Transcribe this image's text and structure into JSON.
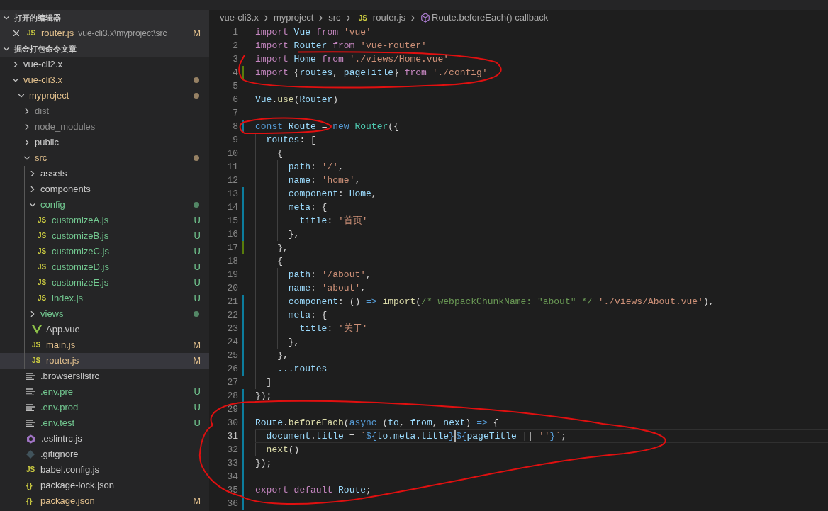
{
  "sidebar": {
    "open_editors": {
      "title": "打开的编辑器",
      "expanded": true,
      "items": [
        {
          "name": "router.js",
          "path": "vue-cli3.x\\myproject\\src",
          "kind": "js",
          "icon_text": "JS",
          "badge": "M",
          "color": "#e2c08d"
        }
      ]
    },
    "workspace": {
      "title": "掘金打包命令文章",
      "expanded": true,
      "tree": [
        {
          "name": "vue-cli2.x",
          "kind": "folder",
          "expanded": false
        },
        {
          "name": "vue-cli3.x",
          "kind": "folder",
          "expanded": true,
          "color": "#e2c08d",
          "dot": true,
          "children": [
            {
              "name": "myproject",
              "kind": "folder",
              "expanded": true,
              "color": "#e2c08d",
              "dot": true,
              "children": [
                {
                  "name": "dist",
                  "kind": "folder",
                  "expanded": false,
                  "color": "#8c8c8c"
                },
                {
                  "name": "node_modules",
                  "kind": "folder",
                  "expanded": false,
                  "color": "#8c8c8c"
                },
                {
                  "name": "public",
                  "kind": "folder",
                  "expanded": false
                },
                {
                  "name": "src",
                  "kind": "folder",
                  "expanded": true,
                  "color": "#e2c08d",
                  "dot": true,
                  "children": [
                    {
                      "name": "assets",
                      "kind": "folder",
                      "expanded": false
                    },
                    {
                      "name": "components",
                      "kind": "folder",
                      "expanded": false
                    },
                    {
                      "name": "config",
                      "kind": "folder",
                      "expanded": true,
                      "color": "#73c991",
                      "dot": true,
                      "children": [
                        {
                          "name": "customizeA.js",
                          "kind": "js",
                          "icon_text": "JS",
                          "color": "#73c991",
                          "badge": "U"
                        },
                        {
                          "name": "customizeB.js",
                          "kind": "js",
                          "icon_text": "JS",
                          "color": "#73c991",
                          "badge": "U"
                        },
                        {
                          "name": "customizeC.js",
                          "kind": "js",
                          "icon_text": "JS",
                          "color": "#73c991",
                          "badge": "U"
                        },
                        {
                          "name": "customizeD.js",
                          "kind": "js",
                          "icon_text": "JS",
                          "color": "#73c991",
                          "badge": "U"
                        },
                        {
                          "name": "customizeE.js",
                          "kind": "js",
                          "icon_text": "JS",
                          "color": "#73c991",
                          "badge": "U"
                        },
                        {
                          "name": "index.js",
                          "kind": "js",
                          "icon_text": "JS",
                          "color": "#73c991",
                          "badge": "U"
                        }
                      ]
                    },
                    {
                      "name": "views",
                      "kind": "folder",
                      "expanded": false,
                      "color": "#73c991",
                      "dot": true
                    },
                    {
                      "name": "App.vue",
                      "kind": "vue"
                    },
                    {
                      "name": "main.js",
                      "kind": "js",
                      "icon_text": "JS",
                      "color": "#e2c08d",
                      "badge": "M",
                      "selected": false
                    },
                    {
                      "name": "router.js",
                      "kind": "js",
                      "icon_text": "JS",
                      "color": "#e2c08d",
                      "badge": "M",
                      "selected": true
                    }
                  ]
                },
                {
                  "name": ".browserslistrc",
                  "kind": "lines"
                },
                {
                  "name": ".env.pre",
                  "kind": "lines",
                  "color": "#73c991",
                  "badge": "U"
                },
                {
                  "name": ".env.prod",
                  "kind": "lines",
                  "color": "#73c991",
                  "badge": "U"
                },
                {
                  "name": ".env.test",
                  "kind": "lines",
                  "color": "#73c991",
                  "badge": "U"
                },
                {
                  "name": ".eslintrc.js",
                  "kind": "eslint"
                },
                {
                  "name": ".gitignore",
                  "kind": "git"
                },
                {
                  "name": "babel.config.js",
                  "kind": "js",
                  "icon_text": "JS"
                },
                {
                  "name": "package-lock.json",
                  "kind": "json",
                  "icon_text": "{}"
                },
                {
                  "name": "package.json",
                  "kind": "json",
                  "icon_text": "{}",
                  "color": "#e2c08d",
                  "badge": "M"
                }
              ]
            }
          ]
        }
      ]
    }
  },
  "breadcrumb": [
    {
      "kind": "folder",
      "text": "vue-cli3.x"
    },
    {
      "kind": "folder",
      "text": "myproject"
    },
    {
      "kind": "folder",
      "text": "src"
    },
    {
      "kind": "js",
      "icon_text": "JS",
      "text": "router.js"
    },
    {
      "kind": "symbol",
      "text": "Route.beforeEach() callback"
    }
  ],
  "code": [
    {
      "n": "1",
      "t": [
        {
          "kind": "kw",
          "text": "import "
        },
        {
          "kind": "var",
          "text": "Vue "
        },
        {
          "kind": "kw",
          "text": "from "
        },
        {
          "kind": "str",
          "text": "'vue'"
        }
      ]
    },
    {
      "n": "2",
      "t": [
        {
          "kind": "kw",
          "text": "import "
        },
        {
          "kind": "var",
          "text": "Router "
        },
        {
          "kind": "kw",
          "text": "from "
        },
        {
          "kind": "str",
          "text": "'vue-router'"
        }
      ]
    },
    {
      "n": "3",
      "t": [
        {
          "kind": "kw",
          "text": "import "
        },
        {
          "kind": "var",
          "text": "Home "
        },
        {
          "kind": "kw",
          "text": "from "
        },
        {
          "kind": "str",
          "text": "'./views/Home.vue'"
        }
      ]
    },
    {
      "n": "4",
      "color": "#587c0c",
      "t": [
        {
          "kind": "kw",
          "text": "import "
        },
        {
          "kind": "p",
          "text": "{"
        },
        {
          "kind": "var",
          "text": "routes"
        },
        {
          "kind": "p",
          "text": ", "
        },
        {
          "kind": "var",
          "text": "pageTitle"
        },
        {
          "kind": "p",
          "text": "} "
        },
        {
          "kind": "kw",
          "text": "from "
        },
        {
          "kind": "str",
          "text": "'./config'"
        }
      ]
    },
    {
      "n": "5"
    },
    {
      "n": "6",
      "t": [
        {
          "kind": "var",
          "text": "Vue"
        },
        {
          "kind": "p",
          "text": "."
        },
        {
          "kind": "fn",
          "text": "use"
        },
        {
          "kind": "p",
          "text": "("
        },
        {
          "kind": "var",
          "text": "Router"
        },
        {
          "kind": "p",
          "text": ")"
        }
      ]
    },
    {
      "n": "7"
    },
    {
      "n": "8",
      "color": "#0c7d9d",
      "t": [
        {
          "kind": "blue",
          "text": "const "
        },
        {
          "kind": "var",
          "text": "Route "
        },
        {
          "kind": "p",
          "text": "= "
        },
        {
          "kind": "blue",
          "text": "new "
        },
        {
          "kind": "cls",
          "text": "Router"
        },
        {
          "kind": "p",
          "text": "({"
        }
      ]
    },
    {
      "n": "9",
      "t": [
        {
          "kind": "var",
          "text": "  routes"
        },
        {
          "kind": "p",
          "text": ": ["
        }
      ]
    },
    {
      "n": "10",
      "t": [
        {
          "kind": "p",
          "text": "    {"
        }
      ]
    },
    {
      "n": "11",
      "t": [
        {
          "kind": "var",
          "text": "      path"
        },
        {
          "kind": "p",
          "text": ": "
        },
        {
          "kind": "str",
          "text": "'/'"
        },
        {
          "kind": "p",
          "text": ","
        }
      ]
    },
    {
      "n": "12",
      "t": [
        {
          "kind": "var",
          "text": "      name"
        },
        {
          "kind": "p",
          "text": ": "
        },
        {
          "kind": "str",
          "text": "'home'"
        },
        {
          "kind": "p",
          "text": ","
        }
      ]
    },
    {
      "n": "13",
      "color": "#0c7d9d",
      "t": [
        {
          "kind": "var",
          "text": "      component"
        },
        {
          "kind": "p",
          "text": ": "
        },
        {
          "kind": "var",
          "text": "Home"
        },
        {
          "kind": "p",
          "text": ","
        }
      ]
    },
    {
      "n": "14",
      "color": "#0c7d9d",
      "t": [
        {
          "kind": "var",
          "text": "      meta"
        },
        {
          "kind": "p",
          "text": ": {"
        }
      ]
    },
    {
      "n": "15",
      "color": "#0c7d9d",
      "t": [
        {
          "kind": "var",
          "text": "        title"
        },
        {
          "kind": "p",
          "text": ": "
        },
        {
          "kind": "str",
          "text": "'首页'"
        }
      ]
    },
    {
      "n": "16",
      "color": "#0c7d9d",
      "t": [
        {
          "kind": "p",
          "text": "      },"
        }
      ]
    },
    {
      "n": "17",
      "color": "#587c0c",
      "t": [
        {
          "kind": "p",
          "text": "    },"
        }
      ]
    },
    {
      "n": "18",
      "t": [
        {
          "kind": "p",
          "text": "    {"
        }
      ]
    },
    {
      "n": "19",
      "t": [
        {
          "kind": "var",
          "text": "      path"
        },
        {
          "kind": "p",
          "text": ": "
        },
        {
          "kind": "str",
          "text": "'/about'"
        },
        {
          "kind": "p",
          "text": ","
        }
      ]
    },
    {
      "n": "20",
      "t": [
        {
          "kind": "var",
          "text": "      name"
        },
        {
          "kind": "p",
          "text": ": "
        },
        {
          "kind": "str",
          "text": "'about'"
        },
        {
          "kind": "p",
          "text": ","
        }
      ]
    },
    {
      "n": "21",
      "color": "#0c7d9d",
      "t": [
        {
          "kind": "var",
          "text": "      component"
        },
        {
          "kind": "p",
          "text": ": () "
        },
        {
          "kind": "blue",
          "text": "=> "
        },
        {
          "kind": "fn",
          "text": "import"
        },
        {
          "kind": "p",
          "text": "("
        },
        {
          "kind": "cmt",
          "text": "/* webpackChunkName: \"about\" */ "
        },
        {
          "kind": "str",
          "text": "'./views/About.vue'"
        },
        {
          "kind": "p",
          "text": "),"
        }
      ]
    },
    {
      "n": "22",
      "color": "#0c7d9d",
      "t": [
        {
          "kind": "var",
          "text": "      meta"
        },
        {
          "kind": "p",
          "text": ": {"
        }
      ]
    },
    {
      "n": "23",
      "color": "#0c7d9d",
      "t": [
        {
          "kind": "var",
          "text": "        title"
        },
        {
          "kind": "p",
          "text": ": "
        },
        {
          "kind": "str",
          "text": "'关于'"
        }
      ]
    },
    {
      "n": "24",
      "color": "#0c7d9d",
      "t": [
        {
          "kind": "p",
          "text": "      },"
        }
      ]
    },
    {
      "n": "25",
      "color": "#0c7d9d",
      "t": [
        {
          "kind": "p",
          "text": "    },"
        }
      ]
    },
    {
      "n": "26",
      "color": "#0c7d9d",
      "t": [
        {
          "kind": "var",
          "text": "    ...routes"
        }
      ]
    },
    {
      "n": "27",
      "t": [
        {
          "kind": "p",
          "text": "  ]"
        }
      ]
    },
    {
      "n": "28",
      "color": "#0c7d9d",
      "t": [
        {
          "kind": "p",
          "text": "});"
        }
      ]
    },
    {
      "n": "29",
      "color": "#0c7d9d"
    },
    {
      "n": "30",
      "color": "#0c7d9d",
      "t": [
        {
          "kind": "var",
          "text": "Route"
        },
        {
          "kind": "p",
          "text": "."
        },
        {
          "kind": "fn",
          "text": "beforeEach"
        },
        {
          "kind": "p",
          "text": "("
        },
        {
          "kind": "blue",
          "text": "async "
        },
        {
          "kind": "p",
          "text": "("
        },
        {
          "kind": "var",
          "text": "to"
        },
        {
          "kind": "p",
          "text": ", "
        },
        {
          "kind": "var",
          "text": "from"
        },
        {
          "kind": "p",
          "text": ", "
        },
        {
          "kind": "var",
          "text": "next"
        },
        {
          "kind": "p",
          "text": ") "
        },
        {
          "kind": "blue",
          "text": "=> "
        },
        {
          "kind": "p",
          "text": "{"
        }
      ]
    },
    {
      "n": "31",
      "color": "#0c7d9d",
      "current": true,
      "t": [
        {
          "kind": "var",
          "text": "  document"
        },
        {
          "kind": "p",
          "text": "."
        },
        {
          "kind": "var",
          "text": "title "
        },
        {
          "kind": "p",
          "text": "= "
        },
        {
          "kind": "str",
          "text": "`"
        },
        {
          "kind": "blue",
          "text": "${"
        },
        {
          "kind": "var",
          "text": "to.meta.title"
        },
        {
          "kind": "blue",
          "text": "}",
          "caret": true
        },
        {
          "kind": "blue",
          "text": "${"
        },
        {
          "kind": "var",
          "text": "pageTitle "
        },
        {
          "kind": "p",
          "text": "|| "
        },
        {
          "kind": "str",
          "text": "''"
        },
        {
          "kind": "blue",
          "text": "}"
        },
        {
          "kind": "str",
          "text": "`"
        },
        {
          "kind": "p",
          "text": ";"
        }
      ]
    },
    {
      "n": "32",
      "color": "#0c7d9d",
      "t": [
        {
          "kind": "fn",
          "text": "  next"
        },
        {
          "kind": "p",
          "text": "()"
        }
      ]
    },
    {
      "n": "33",
      "color": "#0c7d9d",
      "t": [
        {
          "kind": "p",
          "text": "});"
        }
      ]
    },
    {
      "n": "34",
      "color": "#0c7d9d"
    },
    {
      "n": "35",
      "color": "#0c7d9d",
      "t": [
        {
          "kind": "kw",
          "text": "export "
        },
        {
          "kind": "kw",
          "text": "default "
        },
        {
          "kind": "var",
          "text": "Route"
        },
        {
          "kind": "p",
          "text": ";"
        }
      ]
    },
    {
      "n": "36",
      "color": "#0c7d9d"
    }
  ]
}
